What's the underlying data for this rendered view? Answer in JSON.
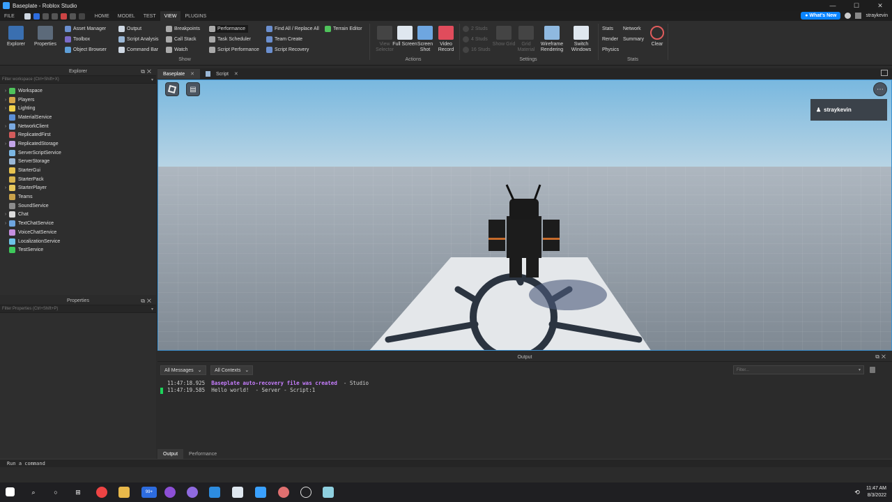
{
  "window": {
    "title": "Baseplate - Roblox Studio",
    "controls": [
      "—",
      "☐",
      "✕"
    ]
  },
  "menubar": {
    "tabs": [
      "FILE",
      "HOME",
      "MODEL",
      "TEST",
      "VIEW",
      "PLUGINS"
    ],
    "active_tab": "VIEW",
    "whats_new": "What's New",
    "username": "straykevin"
  },
  "ribbon": {
    "big_buttons": {
      "explorer": "Explorer",
      "properties": "Properties",
      "view_selector": "View Selector",
      "full_screen": "Full Screen",
      "screen_shot": "Screen Shot",
      "video_record": "Video Record",
      "show_grid": "Show Grid",
      "grid_material": "Grid Material",
      "wireframe": "Wireframe Rendering",
      "switch_windows": "Switch Windows",
      "clear": "Clear"
    },
    "show_items": {
      "asset_manager": "Asset Manager",
      "toolbox": "Toolbox",
      "object_browser": "Object Browser",
      "output": "Output",
      "script_analysis": "Script Analysis",
      "command_bar": "Command Bar",
      "breakpoints": "Breakpoints",
      "call_stack": "Call Stack",
      "watch": "Watch",
      "performance": "Performance",
      "task_scheduler": "Task Scheduler",
      "script_performance": "Script Performance",
      "find_all": "Find All / Replace All",
      "team_create": "Team Create",
      "script_recovery": "Script Recovery",
      "terrain_editor": "Terrain Editor"
    },
    "studs": [
      "2 Studs",
      "4 Studs",
      "16 Studs"
    ],
    "stats_items": {
      "stats": "Stats",
      "network": "Network",
      "render": "Render",
      "summary": "Summary",
      "physics": "Physics"
    },
    "groups": {
      "show": "Show",
      "actions": "Actions",
      "settings": "Settings",
      "stats": "Stats"
    }
  },
  "explorer": {
    "title": "Explorer",
    "filter_placeholder": "Filter workspace (Ctrl+Shift+X)",
    "items": [
      {
        "label": "Workspace",
        "expandable": true,
        "color": "#4fc35b"
      },
      {
        "label": "Players",
        "expandable": true,
        "color": "#d6a74a"
      },
      {
        "label": "Lighting",
        "expandable": true,
        "color": "#f2d14a"
      },
      {
        "label": "MaterialService",
        "expandable": false,
        "color": "#5c8fd6"
      },
      {
        "label": "NetworkClient",
        "expandable": true,
        "color": "#7aa9e0"
      },
      {
        "label": "ReplicatedFirst",
        "expandable": false,
        "color": "#d25b5b"
      },
      {
        "label": "ReplicatedStorage",
        "expandable": true,
        "color": "#c2a4e8"
      },
      {
        "label": "ServerScriptService",
        "expandable": false,
        "color": "#7bb6e3"
      },
      {
        "label": "ServerStorage",
        "expandable": false,
        "color": "#9ab7d6"
      },
      {
        "label": "StarterGui",
        "expandable": false,
        "color": "#e6c24f"
      },
      {
        "label": "StarterPack",
        "expandable": false,
        "color": "#d8b44e"
      },
      {
        "label": "StarterPlayer",
        "expandable": true,
        "color": "#e8c85c"
      },
      {
        "label": "Teams",
        "expandable": false,
        "color": "#c9a24a"
      },
      {
        "label": "SoundService",
        "expandable": false,
        "color": "#8c8c8c"
      },
      {
        "label": "Chat",
        "expandable": true,
        "color": "#dcdcdc"
      },
      {
        "label": "TextChatService",
        "expandable": true,
        "color": "#6ea6e0"
      },
      {
        "label": "VoiceChatService",
        "expandable": false,
        "color": "#c68fe0"
      },
      {
        "label": "LocalizationService",
        "expandable": false,
        "color": "#6ec3e8"
      },
      {
        "label": "TestService",
        "expandable": false,
        "color": "#3ec95b"
      }
    ]
  },
  "properties": {
    "title": "Properties",
    "filter_placeholder": "Filter Properties (Ctrl+Shift+P)"
  },
  "doc_tabs": [
    {
      "label": "Baseplate",
      "active": true
    },
    {
      "label": "Script",
      "active": false
    }
  ],
  "viewport": {
    "player_name": "straykevin"
  },
  "output": {
    "title": "Output",
    "messages_filter": "All Messages",
    "contexts_filter": "All Contexts",
    "filter_placeholder": "Filter...",
    "lines": [
      {
        "time": "11:47:18.925",
        "message": "Baseplate auto-recovery file was created",
        "source": "-  Studio"
      },
      {
        "time": "11:47:19.585",
        "message": "Hello world!",
        "source": "-  Server - Script:1"
      }
    ],
    "tabs": [
      "Output",
      "Performance"
    ]
  },
  "command_bar": {
    "placeholder": "Run a command"
  },
  "taskbar": {
    "time": "11:47 AM",
    "date": "8/3/2022",
    "badge": "99+"
  }
}
